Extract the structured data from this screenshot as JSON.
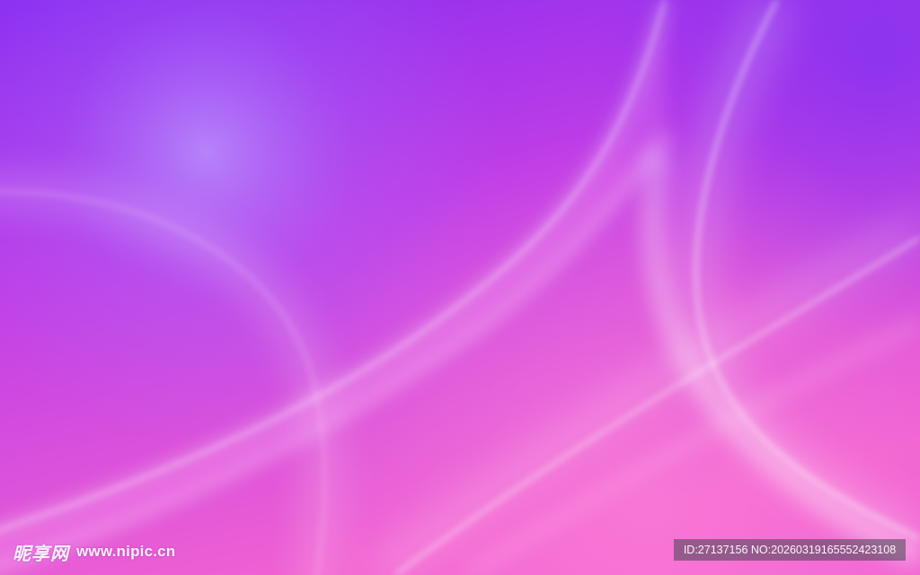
{
  "watermark": {
    "site_cn": "昵享网",
    "site_url": "www.nipic.cn",
    "id_text": "ID:27137156 NO:20260319165552423108"
  },
  "colors": {
    "top": "#8a2cf0",
    "middle": "#c83ee8",
    "bottom": "#f060d0",
    "glow": "#ffffff",
    "badge": "#4a4a52"
  }
}
